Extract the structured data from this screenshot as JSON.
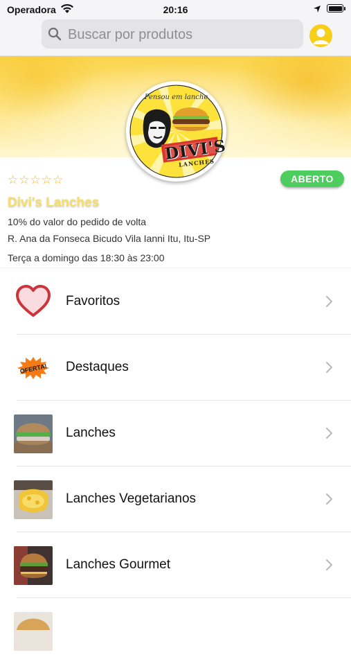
{
  "status_bar": {
    "carrier": "Operadora",
    "time": "20:16"
  },
  "search": {
    "placeholder": "Buscar por produtos"
  },
  "store": {
    "logo_top_text": "Pensou em lanche",
    "logo_name": "DIVI'S",
    "logo_sub": "LANCHES",
    "rating_stars": [
      "☆",
      "☆",
      "☆",
      "☆",
      "☆"
    ],
    "rating_value": 0,
    "status": "ABERTO",
    "name": "Divi's Lanches",
    "cashback": "10% do valor do pedido de volta",
    "address": "R. Ana da Fonseca Bicudo Vila Ianni Itu, Itu-SP",
    "hours": "Terça a domingo das 18:30 às 23:00"
  },
  "categories": [
    {
      "label": "Favoritos",
      "icon": "heart-icon"
    },
    {
      "label": "Destaques",
      "icon": "oferta-badge-icon",
      "badge_text": "OFERTA!"
    },
    {
      "label": "Lanches",
      "icon": "burger-photo"
    },
    {
      "label": "Lanches Vegetarianos",
      "icon": "veggie-burger-photo"
    },
    {
      "label": "Lanches Gourmet",
      "icon": "gourmet-burger-photo"
    }
  ],
  "colors": {
    "accent_yellow": "#f7cf1b",
    "open_green": "#4ccd5e",
    "store_name_yellow": "#f5de6a",
    "star_color": "#f0b534",
    "heart_red": "#c9353b"
  }
}
